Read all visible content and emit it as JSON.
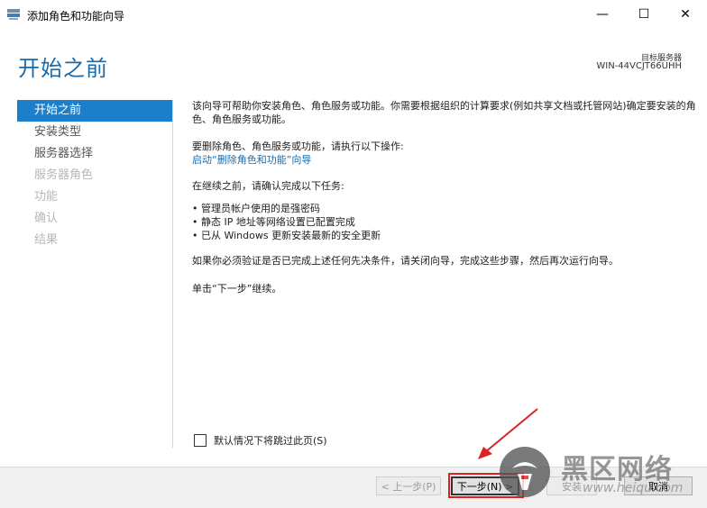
{
  "window": {
    "title": "添加角色和功能向导",
    "minimize_symbol": "—",
    "maximize_symbol": "☐",
    "close_symbol": "✕"
  },
  "header": {
    "title": "开始之前",
    "destination_label": "目标服务器",
    "destination_server": "WIN-44VCJT66UHH"
  },
  "sidebar": {
    "items": [
      {
        "label": "开始之前",
        "state": "active"
      },
      {
        "label": "安装类型",
        "state": "enabled"
      },
      {
        "label": "服务器选择",
        "state": "enabled"
      },
      {
        "label": "服务器角色",
        "state": "disabled"
      },
      {
        "label": "功能",
        "state": "disabled"
      },
      {
        "label": "确认",
        "state": "disabled"
      },
      {
        "label": "结果",
        "state": "disabled"
      }
    ]
  },
  "content": {
    "intro": "该向导可帮助你安装角色、角色服务或功能。你需要根据组织的计算要求(例如共享文档或托管网站)确定要安装的角色、角色服务或功能。",
    "remove_prompt": "要删除角色、角色服务或功能，请执行以下操作:",
    "remove_link": "启动“删除角色和功能”向导",
    "confirm_prompt": "在继续之前，请确认完成以下任务:",
    "tasks": [
      "管理员帐户使用的是强密码",
      "静态 IP 地址等网络设置已配置完成",
      "已从 Windows 更新安装最新的安全更新"
    ],
    "prereq_note": "如果你必须验证是否已完成上述任何先决条件，请关闭向导，完成这些步骤，然后再次运行向导。",
    "continue_note": "单击“下一步”继续。"
  },
  "skip_checkbox": {
    "label": "默认情况下将跳过此页(S)",
    "checked": false
  },
  "footer": {
    "prev_label": "< 上一步(P)",
    "next_label": "下一步(N) >",
    "install_label": "安装",
    "cancel_label": "取消"
  },
  "watermark": {
    "text": "黑区网络",
    "url": "www.heiqu.com"
  },
  "colors": {
    "accent": "#1c7fc9",
    "title_blue": "#1a6aa8",
    "highlight": "#e02020"
  }
}
